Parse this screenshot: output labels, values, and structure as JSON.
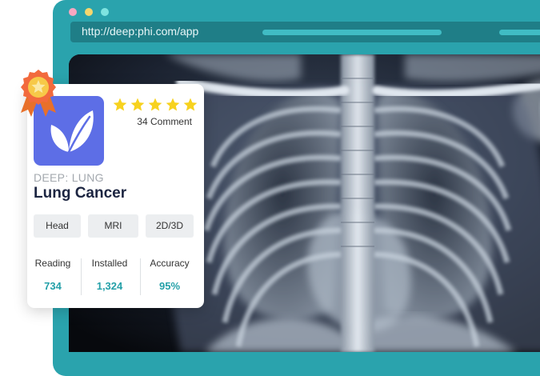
{
  "browser": {
    "url": "http://deep:phi.com/app",
    "colors": {
      "frame": "#2aa3ad",
      "urlbar": "#1f7e87",
      "dot_pink": "#f6a7c1",
      "dot_yellow": "#f5d76e",
      "dot_cyan": "#7ee3e0"
    }
  },
  "viewer": {
    "image": "chest-xray-image"
  },
  "card": {
    "icon": "leaf-logo-icon",
    "rating": 5,
    "comments": "34 Comment",
    "subtitle": "DEEP: LUNG",
    "title": "Lung Cancer",
    "tags": [
      "Head",
      "MRI",
      "2D/3D"
    ],
    "stats": [
      {
        "label": "Reading",
        "value": "734"
      },
      {
        "label": "Installed",
        "value": "1,324"
      },
      {
        "label": "Accuracy",
        "value": "95%"
      }
    ],
    "colors": {
      "icon_bg": "#5d6ee6",
      "star": "#f7d21e",
      "stat_value": "#24a0a8",
      "title": "#1c2541"
    }
  },
  "badge": {
    "icon": "award-medal-icon"
  }
}
